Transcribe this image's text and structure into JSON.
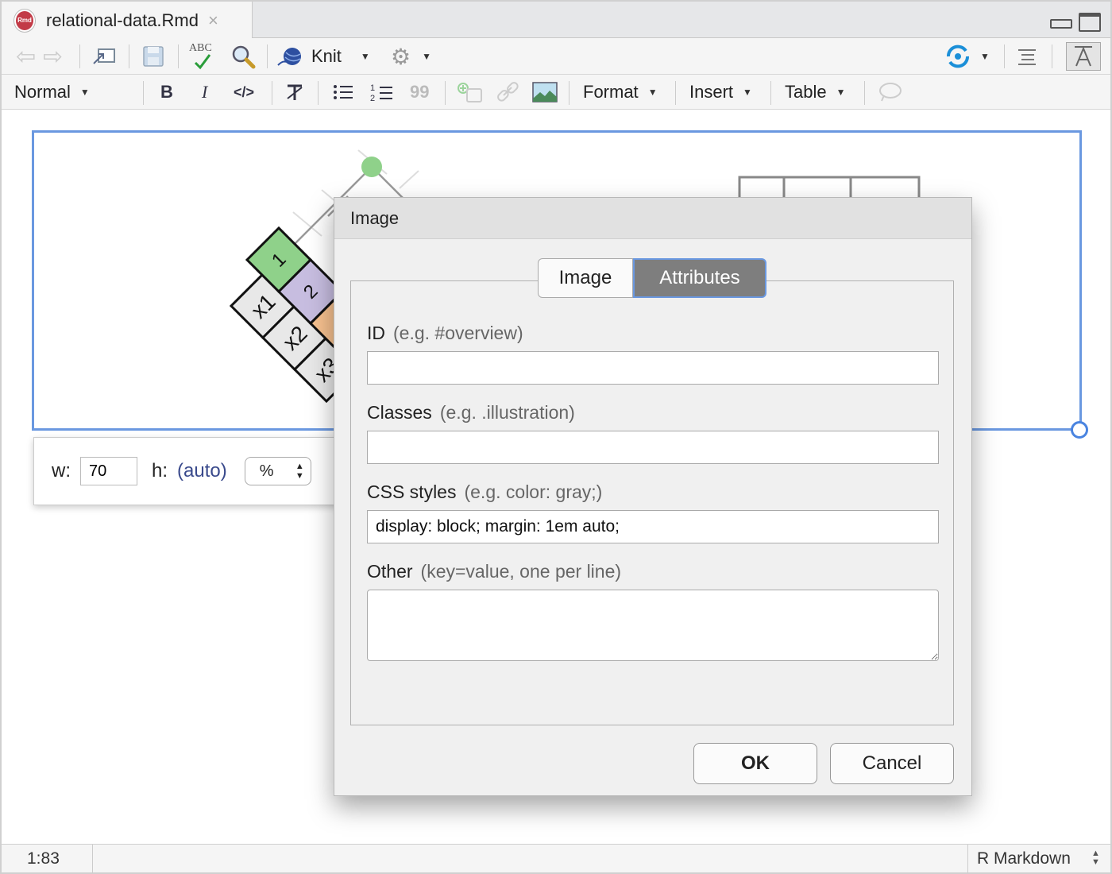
{
  "tab": {
    "filename": "relational-data.Rmd",
    "icon_text": "Rmd",
    "close": "×"
  },
  "toolbar": {
    "spellcheck_text": "ABC",
    "knit_label": "Knit"
  },
  "format_bar": {
    "style_label": "Normal",
    "bold": "B",
    "italic": "I",
    "code": "</>",
    "quote": "99",
    "format_label": "Format",
    "insert_label": "Insert",
    "table_label": "Table"
  },
  "image_popup": {
    "w_label": "w:",
    "w_value": "70",
    "h_label": "h:",
    "h_value": "(auto)",
    "unit": "%"
  },
  "diagram": {
    "cells": [
      "1",
      "2",
      "x1",
      "x2",
      "x3"
    ],
    "colors": {
      "green": "#8fd18a",
      "purple": "#c7bde0",
      "orange": "#f7c18f",
      "grey": "#e8e8e8"
    }
  },
  "dialog": {
    "title": "Image",
    "tabs": [
      "Image",
      "Attributes"
    ],
    "active_tab": "Attributes",
    "fields": {
      "id": {
        "label": "ID",
        "hint": "(e.g. #overview)",
        "value": ""
      },
      "classes": {
        "label": "Classes",
        "hint": "(e.g. .illustration)",
        "value": ""
      },
      "css": {
        "label": "CSS styles",
        "hint": "(e.g. color: gray;)",
        "value": "display: block; margin: 1em auto;"
      },
      "other": {
        "label": "Other",
        "hint": "(key=value, one per line)",
        "value": ""
      }
    },
    "ok_label": "OK",
    "cancel_label": "Cancel"
  },
  "status": {
    "position": "1:83",
    "language": "R Markdown"
  },
  "colors": {
    "selection_border": "#6a98e0",
    "active_tab_bg": "#7e7e7e",
    "rmd_icon": "#c23b47",
    "publish_icon": "#1b8fd8"
  }
}
